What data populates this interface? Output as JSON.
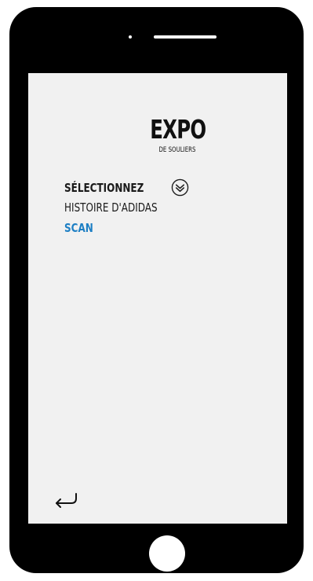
{
  "header": {
    "title": "EXPO",
    "subtitle": "DE SOULIERS"
  },
  "menu": {
    "items": [
      {
        "label": "SÉLECTIONNEZ",
        "icon": "chevron-double-down-circle-icon"
      },
      {
        "label": "HISTOIRE D'ADIDAS"
      },
      {
        "label": "SCAN"
      }
    ]
  },
  "footer": {
    "back_icon": "return-arrow-icon"
  },
  "colors": {
    "device_frame": "#000000",
    "screen_background": "#f1f1f1",
    "text": "#111111",
    "accent": "#1d7fc4"
  }
}
